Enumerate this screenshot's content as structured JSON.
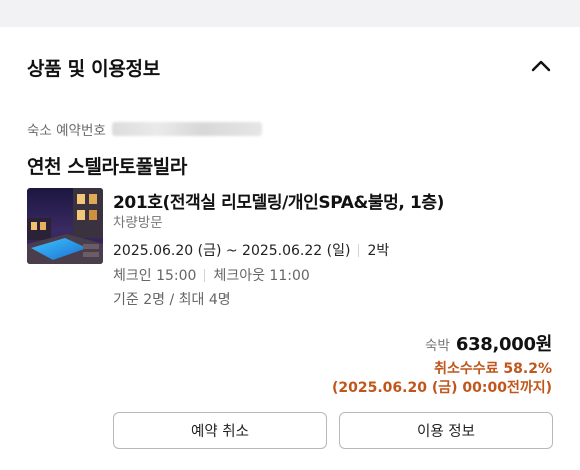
{
  "section": {
    "title": "상품 및 이용정보"
  },
  "booking": {
    "number_label": "숙소 예약번호",
    "hotel_name": "연천 스텔라토풀빌라",
    "room_name": "201호(전객실 리모델링/개인SPA&불멍, 1층)",
    "visit_type": "차량방문",
    "date_range": "2025.06.20 (금) ~ 2025.06.22 (일)",
    "nights": "2박",
    "checkin": "체크인 15:00",
    "checkout": "체크아웃 11:00",
    "capacity": "기준 2명 / 최대 4명"
  },
  "price": {
    "label": "숙박",
    "amount": "638,000원",
    "cancel_fee": "취소수수료 58.2%",
    "cancel_fee_until": "(2025.06.20 (금) 00:00전까지)"
  },
  "buttons": {
    "cancel": "예약 취소",
    "info": "이용 정보"
  },
  "colors": {
    "fee_accent": "#c0561b",
    "background_band": "#f2f2f4"
  },
  "icons": {
    "collapse": "chevron-up-icon",
    "thumbnail": "pool-villa-thumbnail"
  }
}
